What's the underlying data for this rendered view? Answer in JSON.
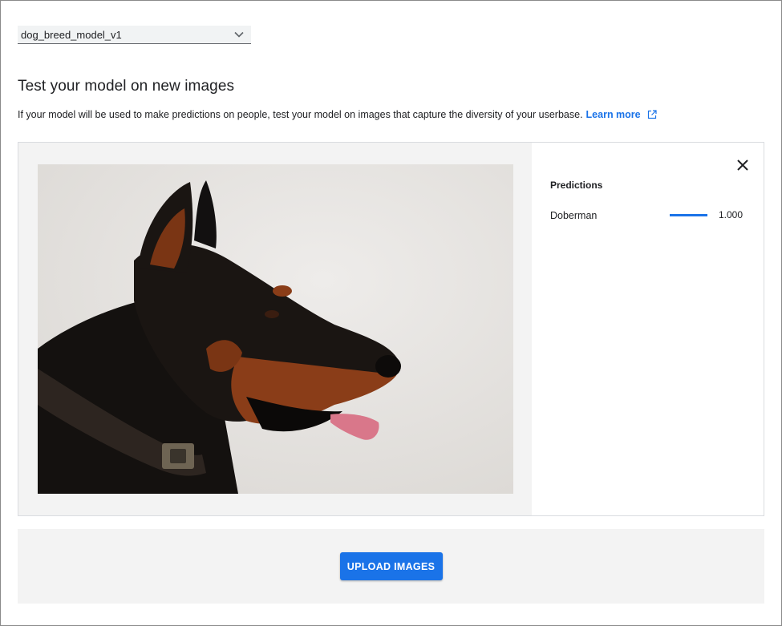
{
  "model_select": {
    "value": "dog_breed_model_v1",
    "icon": "chevron-down-icon"
  },
  "section": {
    "title": "Test your model on new images",
    "description": "If your model will be used to make predictions on people, test your model on images that capture the diversity of your userbase.",
    "learn_more": "Learn more",
    "learn_more_icon": "open-in-new-icon"
  },
  "predictions": {
    "title": "Predictions",
    "close_icon": "close-icon",
    "items": [
      {
        "label": "Doberman",
        "score": "1.000",
        "fraction": 1.0
      }
    ]
  },
  "upload": {
    "button_label": "UPLOAD IMAGES"
  },
  "colors": {
    "accent": "#1a73e8",
    "panel_bg": "#f3f3f3"
  }
}
